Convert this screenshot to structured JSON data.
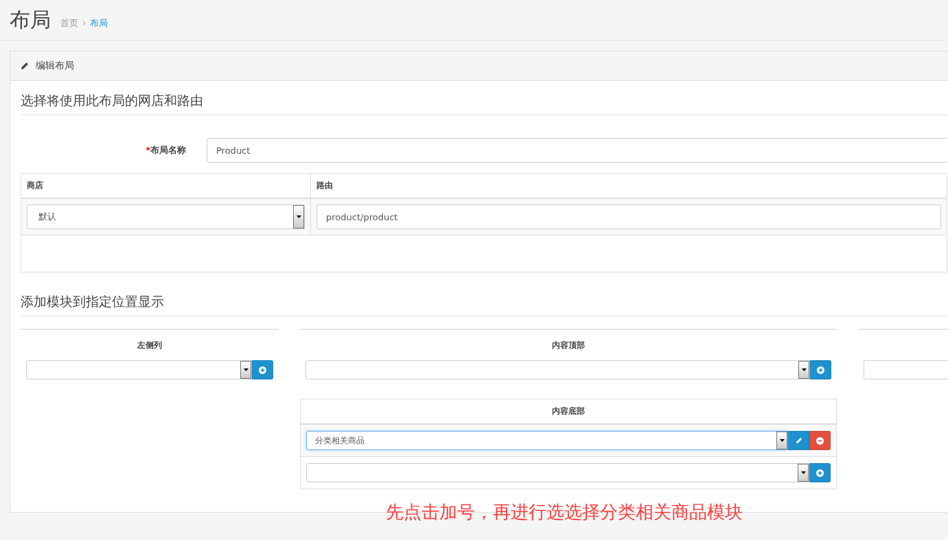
{
  "page_title": "布局",
  "breadcrumb": [
    {
      "label": "首页",
      "selected": false
    },
    {
      "label": "布局",
      "selected": true
    }
  ],
  "panel": {
    "title": "编辑布局"
  },
  "section_route": {
    "heading": "选择将使用此布局的网店和路由",
    "name_field": {
      "label": "布局名称",
      "required_mark": "*",
      "value": "Product"
    },
    "table": {
      "columns": [
        "商店",
        "路由"
      ],
      "rows": [
        {
          "store": "默认",
          "route": "product/product"
        }
      ]
    }
  },
  "section_modules": {
    "heading": "添加模块到指定位置显示",
    "columns": [
      {
        "blocks": [
          {
            "kind": "plain",
            "title": "左侧列"
          }
        ]
      },
      {
        "blocks": [
          {
            "kind": "plain",
            "title": "内容顶部"
          },
          {
            "kind": "boxed",
            "title": "内容底部",
            "modules": [
              {
                "value": "分类相关商品",
                "focused": true
              }
            ]
          }
        ]
      },
      {
        "blocks": [
          {
            "kind": "plain"
          }
        ]
      }
    ]
  },
  "annotation": "先点击加号，再进行选选择分类相关商品模块"
}
